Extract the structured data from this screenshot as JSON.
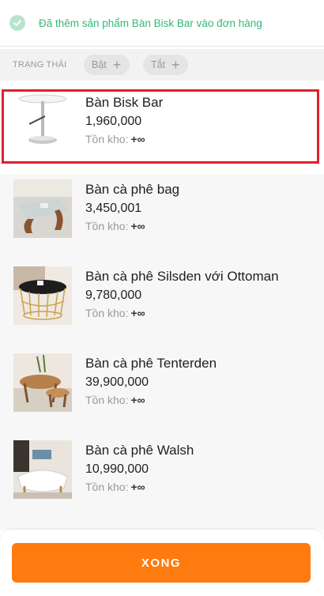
{
  "toast": {
    "message": "Đã thêm sản phẩm Bàn Bisk Bar vào đơn hàng",
    "icon": "check-circle-icon"
  },
  "filter": {
    "label": "TRẠNG THÁI",
    "chips": [
      {
        "label": "Bật"
      },
      {
        "label": "Tắt"
      }
    ]
  },
  "products": [
    {
      "name": "Bàn Bisk Bar",
      "price": "1,960,000",
      "stock_label": "Tồn kho:",
      "stock_value": "+∞",
      "selected": true
    },
    {
      "name": "Bàn cà phê bag",
      "price": "3,450,001",
      "stock_label": "Tồn kho:",
      "stock_value": "+∞"
    },
    {
      "name": "Bàn cà phê Silsden với Ottoman",
      "price": "9,780,000",
      "stock_label": "Tồn kho:",
      "stock_value": "+∞"
    },
    {
      "name": "Bàn cà phê Tenterden",
      "price": "39,900,000",
      "stock_label": "Tồn kho:",
      "stock_value": "+∞"
    },
    {
      "name": "Bàn cà phê Walsh",
      "price": "10,990,000",
      "stock_label": "Tồn kho:",
      "stock_value": "+∞"
    }
  ],
  "footer": {
    "done_label": "XONG"
  },
  "colors": {
    "accent": "#ff7a0f",
    "success": "#35b87a",
    "selection": "#e0202c"
  }
}
